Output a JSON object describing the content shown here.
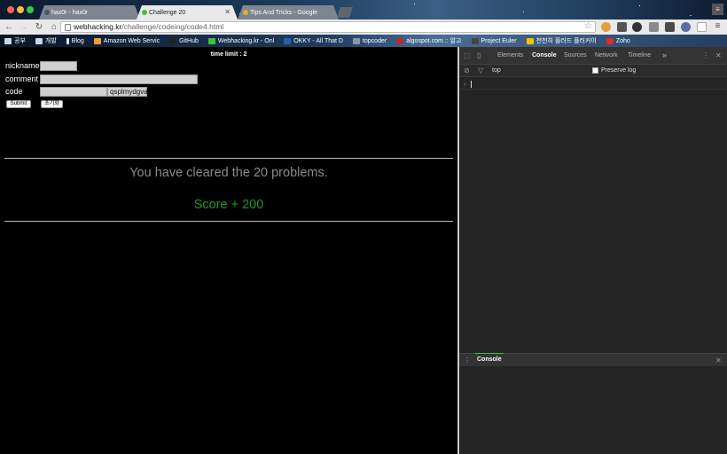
{
  "tabs": [
    {
      "label": "hax0r - hax0r",
      "active": false
    },
    {
      "label": "Challenge 20",
      "active": true
    },
    {
      "label": "Tips And Tricks - Google",
      "active": false
    }
  ],
  "omnibox": {
    "host": "webhacking.kr",
    "path": "/challenge/codeing/code4.html"
  },
  "bookmarks": [
    {
      "label": "공부",
      "icon": "folder-icon",
      "color": "#c9d6e6"
    },
    {
      "label": "개발",
      "icon": "folder-icon",
      "color": "#c9d6e6"
    },
    {
      "label": "Blog",
      "icon": "pin-icon",
      "color": "#e8e8e8"
    },
    {
      "label": "Amazon Web Servic",
      "icon": "amazon-icon",
      "color": "#f0a030"
    },
    {
      "label": "GitHub",
      "icon": "github-icon",
      "color": "#222222"
    },
    {
      "label": "Webhacking.kr - Onl",
      "icon": "webhacking-icon",
      "color": "#3fbf3f"
    },
    {
      "label": "OKKY - All That D",
      "icon": "okky-icon",
      "color": "#2a5db0"
    },
    {
      "label": "topcoder",
      "icon": "topcoder-icon",
      "color": "#8899aa"
    },
    {
      "label": "algospot.com :: 알고",
      "icon": "algospot-icon",
      "color": "#d02020"
    },
    {
      "label": "Project Euler",
      "icon": "euler-icon",
      "color": "#444444"
    },
    {
      "label": "천천히 플러드 플러커이",
      "icon": "blog-icon",
      "color": "#f2c200"
    },
    {
      "label": "Zoho",
      "icon": "zoho-icon",
      "color": "#e02828"
    }
  ],
  "page": {
    "time_limit": "time limit : 2",
    "nickname_label": "nickname",
    "comment_label": "comment",
    "code_label": "code",
    "code_value": "qsplmydgva",
    "submit_label": "Submit",
    "reset_label": "초기화",
    "cleared_text": "You have cleared the 20 problems.",
    "score_text": "Score + 200"
  },
  "devtools": {
    "tabs": [
      "Elements",
      "Console",
      "Sources",
      "Network",
      "Timeline"
    ],
    "active_tab": "Console",
    "more": "»",
    "context": "top",
    "preserve_log": "Preserve log",
    "prompt": "›",
    "drawer_title": "Console"
  }
}
